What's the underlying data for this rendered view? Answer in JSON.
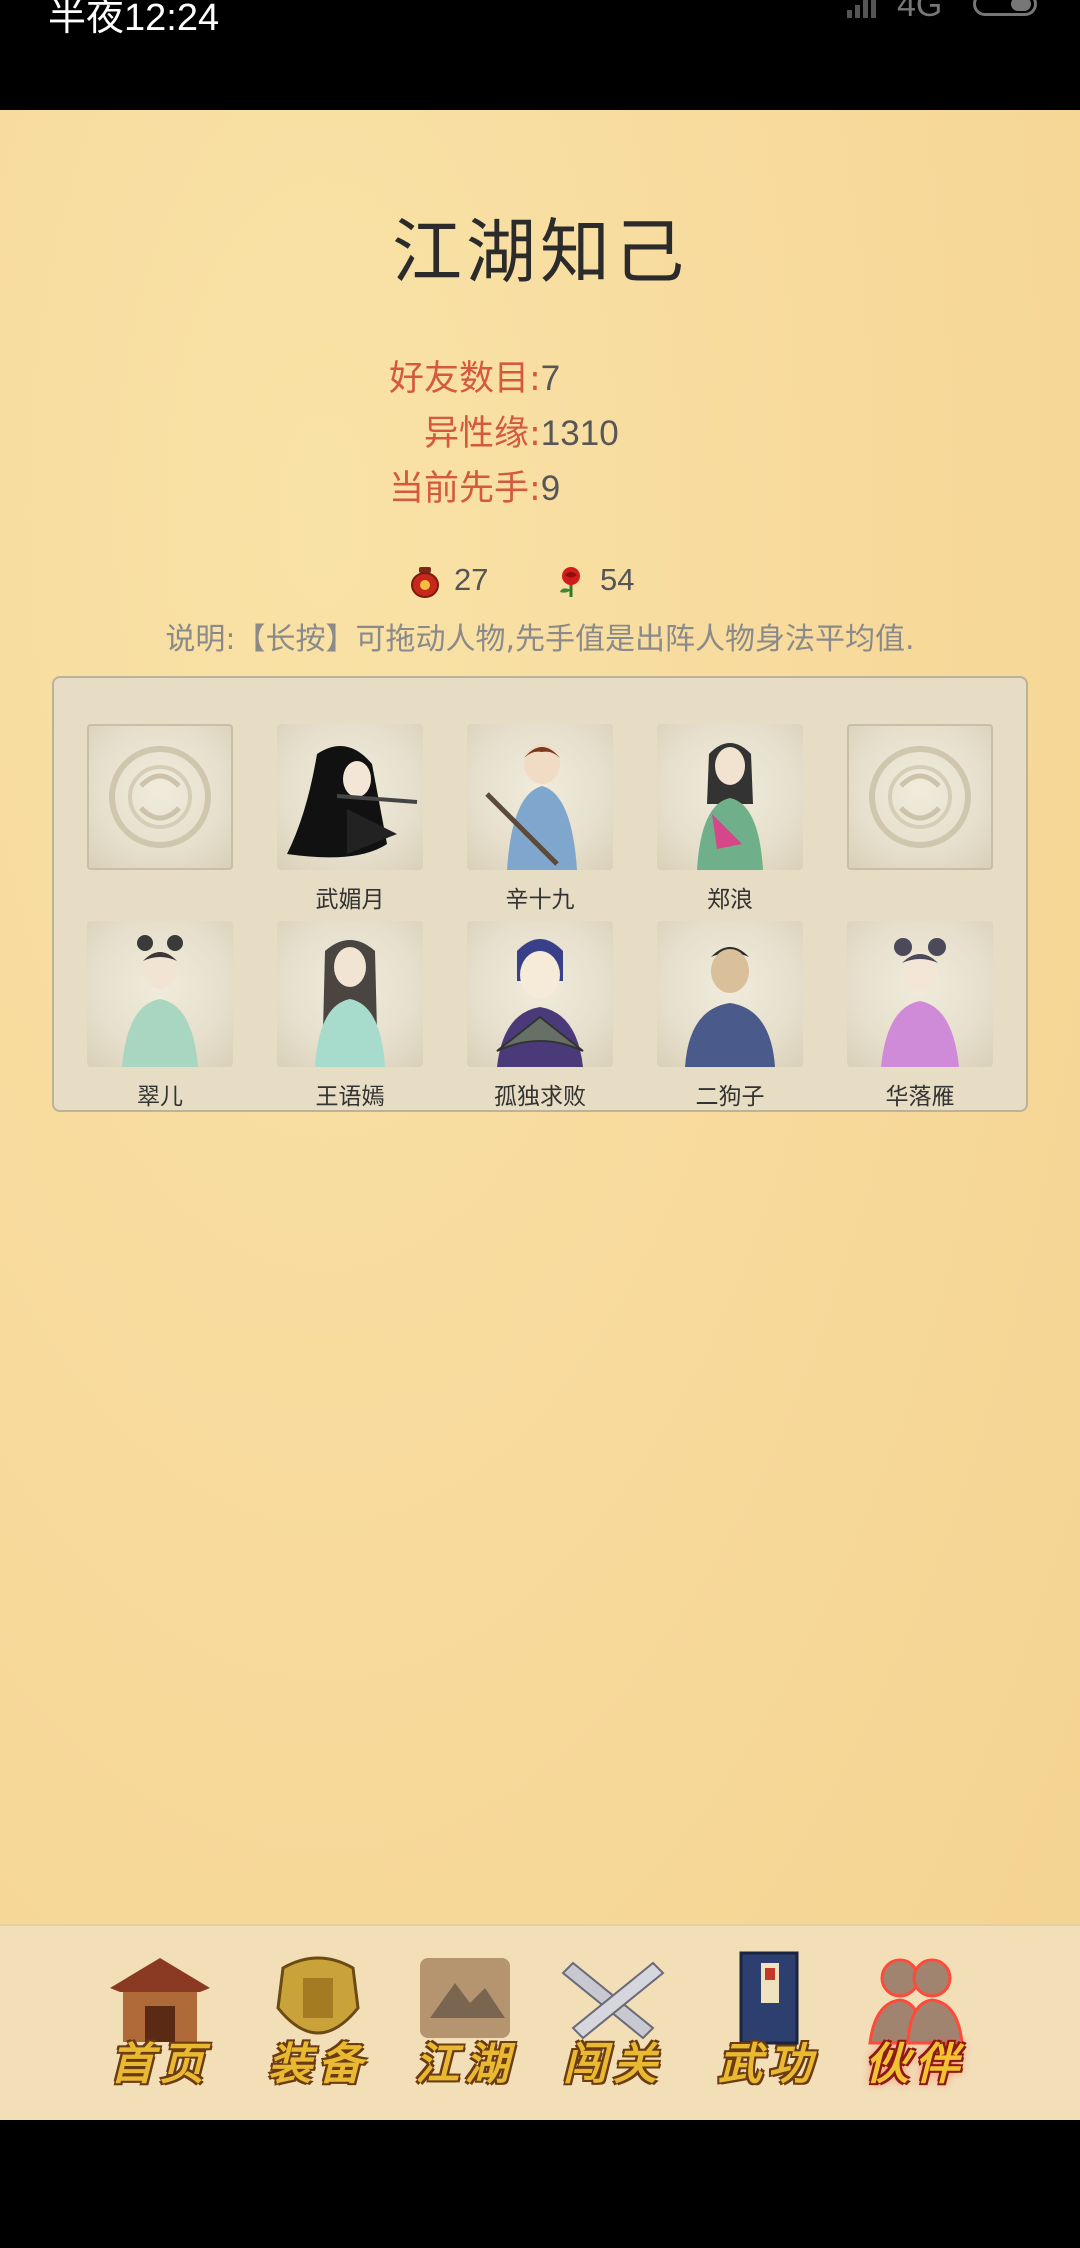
{
  "status_bar": {
    "time": "半夜12:24",
    "network": "4G"
  },
  "page_title": "江湖知己",
  "stats": {
    "friends_label": "好友数目:",
    "friends_value": "7",
    "romance_label": "异性缘:",
    "romance_value": "1310",
    "initiative_label": "当前先手:",
    "initiative_value": "9"
  },
  "resources": {
    "wine_count": "27",
    "rose_count": "54"
  },
  "note": "说明:【长按】可拖动人物,先手值是出阵人物身法平均值.",
  "team_row": [
    {
      "name": "",
      "empty": true
    },
    {
      "name": "武媚月"
    },
    {
      "name": "辛十九"
    },
    {
      "name": "郑浪"
    },
    {
      "name": "",
      "empty": true
    }
  ],
  "roster_row": [
    {
      "name": "翠儿"
    },
    {
      "name": "王语嫣"
    },
    {
      "name": "孤独求败"
    },
    {
      "name": "二狗子"
    },
    {
      "name": "华落雁"
    }
  ],
  "tabs": [
    {
      "label": "首页",
      "icon": "house-icon"
    },
    {
      "label": "装备",
      "icon": "armor-icon"
    },
    {
      "label": "江湖",
      "icon": "scroll-icon"
    },
    {
      "label": "闯关",
      "icon": "crossed-swords-icon"
    },
    {
      "label": "武功",
      "icon": "book-icon"
    },
    {
      "label": "伙伴",
      "icon": "partners-icon",
      "active": true
    }
  ],
  "colors": {
    "label_red": "#d4593f",
    "gold": "#e8b931"
  }
}
